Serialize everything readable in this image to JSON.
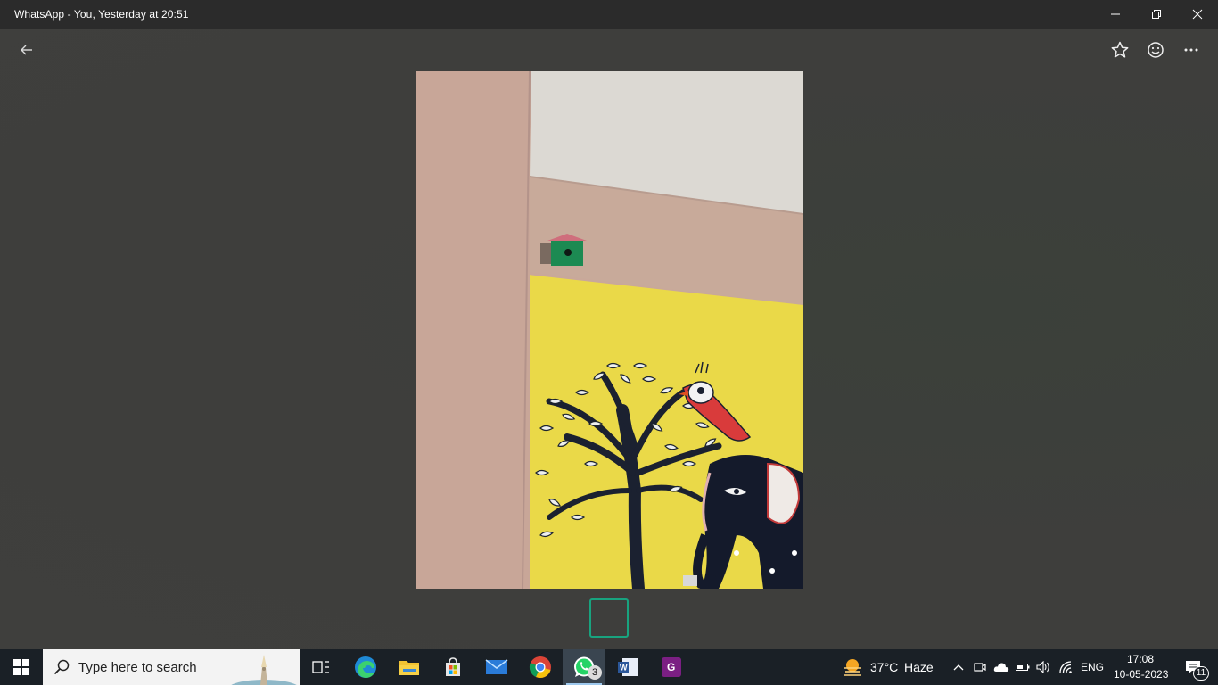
{
  "window": {
    "title": "WhatsApp - You, Yesterday at 20:51",
    "minimize_icon": "minimize-icon",
    "restore_icon": "restore-icon",
    "close_icon": "close-icon"
  },
  "viewer": {
    "back_icon": "back-arrow-icon",
    "star_icon": "star-icon",
    "emoji_icon": "emoji-icon",
    "more_icon": "more-icon"
  },
  "taskbar": {
    "search_placeholder": "Type here to search",
    "whatsapp_badge": "3",
    "weather_temp": "37°C",
    "weather_desc": "Haze",
    "language": "ENG",
    "time": "17:08",
    "date": "10-05-2023",
    "notification_count": "11",
    "apps": [
      "start-icon",
      "task-view-icon",
      "edge-icon",
      "file-explorer-icon",
      "store-icon",
      "mail-icon",
      "chrome-icon",
      "whatsapp-icon",
      "word-icon",
      "pdf-app-icon"
    ]
  },
  "colors": {
    "accent": "#18a37f",
    "taskbar": "#1a2026",
    "titlebar": "#2b2b2b"
  }
}
